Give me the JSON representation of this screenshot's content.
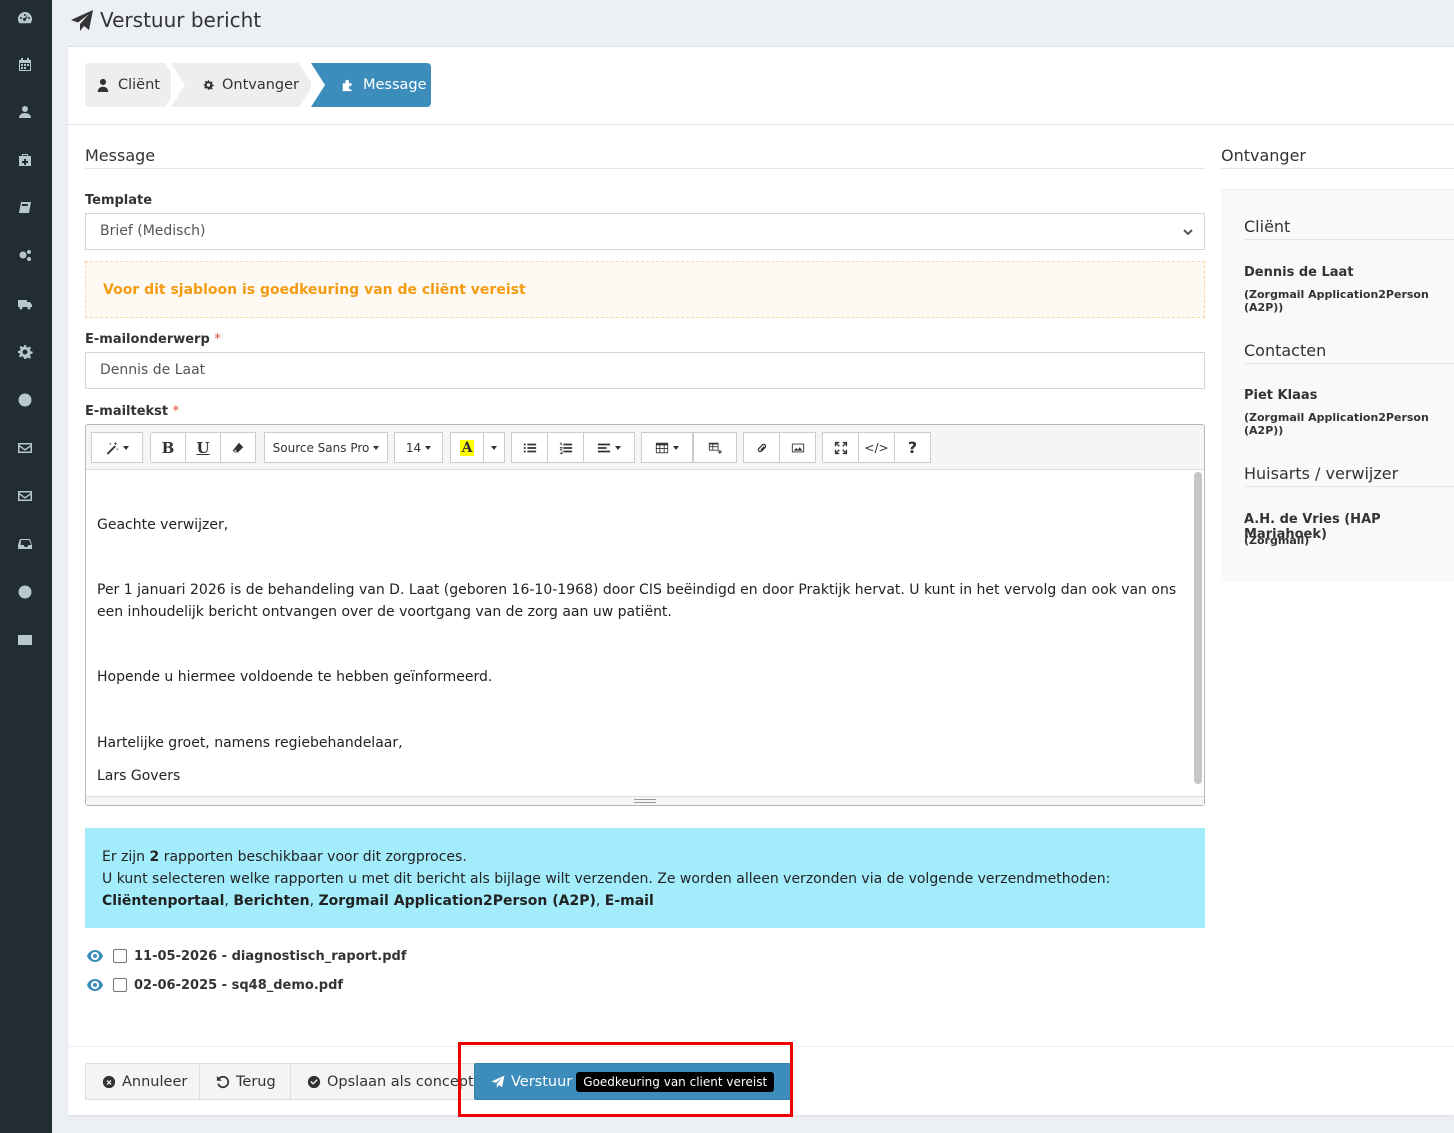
{
  "header": {
    "title": "Verstuur bericht"
  },
  "sidebar": {
    "icons": [
      "dashboard-icon",
      "calendar-icon",
      "user-icon",
      "medkit-icon",
      "book-icon",
      "cogs-icon",
      "truck-icon",
      "gear-icon",
      "globe-icon",
      "envelope-icon",
      "envelope-icon",
      "inbox-icon",
      "globe-icon",
      "envelope-icon"
    ]
  },
  "steps": [
    {
      "label": "Cliënt",
      "icon": "user-icon"
    },
    {
      "label": "Ontvanger",
      "icon": "gear-icon"
    },
    {
      "label": "Message",
      "icon": "puzzle-icon",
      "active": true
    }
  ],
  "message": {
    "section_title": "Message",
    "template_label": "Template",
    "template_value": "Brief (Medisch)",
    "warning": "Voor dit sjabloon is goedkeuring van de cliënt vereist",
    "subject_label": "E-mailonderwerp",
    "subject_value": "Dennis de Laat",
    "body_label": "E-mailtekst",
    "required_mark": "*",
    "toolbar": {
      "font_name": "Source Sans Pro",
      "font_size": "14"
    },
    "body": {
      "greeting": "Geachte verwijzer,",
      "paragraph": "Per 1 januari 2026 is de behandeling van D. Laat (geboren 16-10-1968) door CIS beëindigd en door Praktijk hervat. U kunt in het vervolg dan ook van ons een inhoudelijk bericht ontvangen over de voortgang van de zorg aan uw patiënt.",
      "closing_line": "Hopende u hiermee voldoende te hebben geïnformeerd.",
      "regards": "Hartelijke groet, namens regiebehandelaar,",
      "signature": "Lars Govers"
    }
  },
  "info": {
    "line1_pre": "Er zijn ",
    "line1_count": "2",
    "line1_post": " rapporten beschikbaar voor dit zorgproces.",
    "line2": "U kunt selecteren welke rapporten u met dit bericht als bijlage wilt verzenden. Ze worden alleen verzonden via de volgende verzendmethoden: ",
    "method1": "Cliëntenportaal",
    "sep": ", ",
    "method2": "Berichten",
    "method3": "Zorgmail Application2Person (A2P)",
    "method4": "E-mail"
  },
  "attachments": [
    {
      "label": "11-05-2026 - diagnostisch_raport.pdf",
      "checked": false
    },
    {
      "label": "02-06-2025 - sq48_demo.pdf",
      "checked": false
    }
  ],
  "buttons": {
    "cancel": "Annuleer",
    "back": "Terug",
    "save_draft": "Opslaan als concept",
    "send": "Verstuur",
    "send_tooltip": "Goedkeuring van client vereist"
  },
  "recipient": {
    "title": "Ontvanger",
    "client_title": "Cliënt",
    "client_name": "Dennis de Laat",
    "client_method": "(Zorgmail Application2Person (A2P))",
    "contacts_title": "Contacten",
    "contact_name": "Piet Klaas",
    "contact_method": "(Zorgmail Application2Person (A2P))",
    "gp_title": "Huisarts / verwijzer",
    "gp_name": "A.H. de Vries (HAP Mariahoek)",
    "gp_method": "(Zorgmail)"
  },
  "colors": {
    "primary": "#3c8dbc",
    "warning": "#f39c12",
    "info_bg": "#a3ecfb",
    "sidebar": "#222d32",
    "highlight": "#ee0000"
  }
}
